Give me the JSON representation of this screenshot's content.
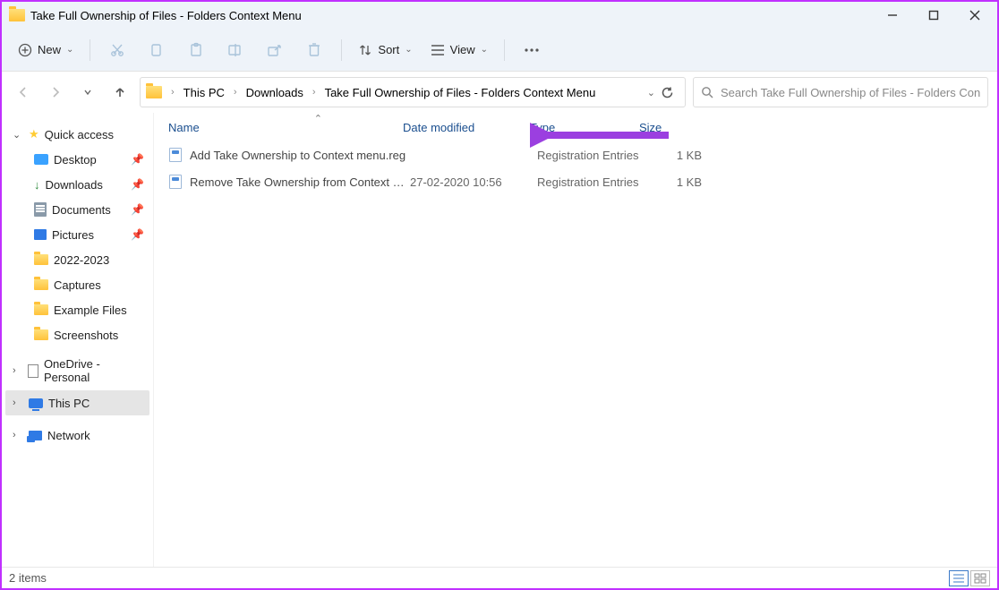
{
  "window": {
    "title": "Take Full Ownership of Files - Folders Context Menu"
  },
  "toolbar": {
    "new": "New",
    "sort": "Sort",
    "view": "View"
  },
  "breadcrumb": {
    "parts": [
      "This PC",
      "Downloads",
      "Take Full Ownership of Files - Folders Context Menu"
    ]
  },
  "search": {
    "placeholder": "Search Take Full Ownership of Files - Folders Context M..."
  },
  "sidebar": {
    "quick_access": "Quick access",
    "desktop": "Desktop",
    "downloads": "Downloads",
    "documents": "Documents",
    "pictures": "Pictures",
    "f_2022_2023": "2022-2023",
    "captures": "Captures",
    "example_files": "Example Files",
    "screenshots": "Screenshots",
    "onedrive": "OneDrive - Personal",
    "this_pc": "This PC",
    "network": "Network"
  },
  "columns": {
    "name": "Name",
    "date": "Date modified",
    "type": "Type",
    "size": "Size"
  },
  "files": [
    {
      "name": "Add Take Ownership to Context menu.reg",
      "date": "",
      "type": "Registration Entries",
      "size": "1 KB"
    },
    {
      "name": "Remove Take Ownership from Context M...",
      "date": "27-02-2020 10:56",
      "type": "Registration Entries",
      "size": "1 KB"
    }
  ],
  "status": {
    "items": "2 items"
  }
}
